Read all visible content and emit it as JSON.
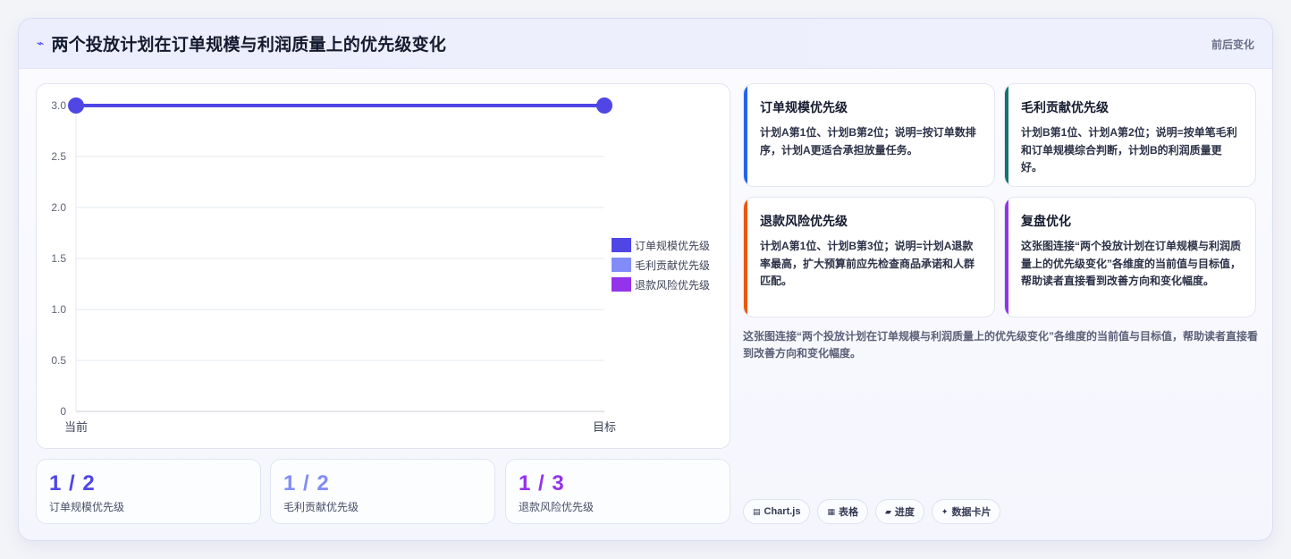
{
  "header": {
    "icon": "sparkline-icon",
    "title": "两个投放计划在订单规模与利润质量上的优先级变化",
    "tag": "前后变化"
  },
  "chart_data": {
    "type": "line",
    "categories": [
      "当前",
      "目标"
    ],
    "series": [
      {
        "name": "订单规模优先级",
        "values": [
          3,
          3
        ],
        "color": "#4f46e5"
      },
      {
        "name": "毛利贡献优先级",
        "values": [
          null,
          null
        ],
        "color": "#818cf8"
      },
      {
        "name": "退款风险优先级",
        "values": [
          null,
          null
        ],
        "color": "#9333ea"
      }
    ],
    "ylim": [
      0,
      3
    ],
    "yticks": [
      "0",
      "0.5",
      "1.0",
      "1.5",
      "2.0",
      "2.5",
      "3.0"
    ],
    "grid": true,
    "legend": "right"
  },
  "stats": [
    {
      "value": "1 / 2",
      "label": "订单规模优先级",
      "color": "#4f46e5"
    },
    {
      "value": "1 / 2",
      "label": "毛利贡献优先级",
      "color": "#818cf8"
    },
    {
      "value": "1 / 3",
      "label": "退款风险优先级",
      "color": "#9333ea"
    }
  ],
  "cards": [
    {
      "title": "订单规模优先级",
      "body": "计划A第1位、计划B第2位；说明=按订单数排序，计划A更适合承担放量任务。",
      "accent": "#2563eb"
    },
    {
      "title": "毛利贡献优先级",
      "body": "计划B第1位、计划A第2位；说明=按单笔毛利和订单规模综合判断，计划B的利润质量更好。",
      "accent": "#0f766e"
    },
    {
      "title": "退款风险优先级",
      "body": "计划A第1位、计划B第3位；说明=计划A退款率最高，扩大预算前应先检查商品承诺和人群匹配。",
      "accent": "#ea580c"
    },
    {
      "title": "复盘优化",
      "body": "这张图连接“两个投放计划在订单规模与利润质量上的优先级变化”各维度的当前值与目标值，帮助读者直接看到改善方向和变化幅度。",
      "accent": "#9333ea"
    }
  ],
  "note": "这张图连接“两个投放计划在订单规模与利润质量上的优先级变化”各维度的当前值与目标值，帮助读者直接看到改善方向和变化幅度。",
  "pills": [
    {
      "icon": "chart-icon",
      "glyph": "▤",
      "label": "Chart.js"
    },
    {
      "icon": "table-icon",
      "glyph": "▦",
      "label": "表格"
    },
    {
      "icon": "progress-icon",
      "glyph": "▰",
      "label": "进度"
    },
    {
      "icon": "data-card-icon",
      "glyph": "✦",
      "label": "数据卡片"
    }
  ]
}
